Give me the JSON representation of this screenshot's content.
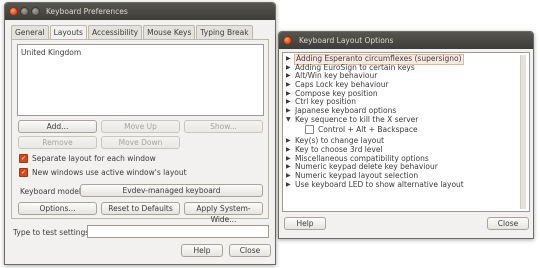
{
  "prefs": {
    "title": "Keyboard Preferences",
    "tabs": [
      "General",
      "Layouts",
      "Accessibility",
      "Mouse Keys",
      "Typing Break"
    ],
    "layouts": [
      "United Kingdom"
    ],
    "buttons": {
      "add": "Add...",
      "move_up": "Move Up",
      "show": "Show...",
      "remove": "Remove",
      "move_down": "Move Down",
      "options": "Options...",
      "reset": "Reset to Defaults",
      "apply": "Apply System-Wide...",
      "help": "Help",
      "close": "Close"
    },
    "checks": [
      {
        "label": "Separate layout for each window",
        "checked": true
      },
      {
        "label": "New windows use active window's layout",
        "checked": true
      }
    ],
    "model_label": "Keyboard model:",
    "model_value": "Evdev-managed keyboard",
    "test_label": "Type to test settings:",
    "test_value": ""
  },
  "options": {
    "title": "Keyboard Layout Options",
    "items": [
      {
        "label": "Adding Esperanto circumflexes (supersigno)",
        "expanded": false,
        "selected": true
      },
      {
        "label": "Adding EuroSign to certain keys",
        "expanded": false
      },
      {
        "label": "Alt/Win key behaviour",
        "expanded": false
      },
      {
        "label": "Caps Lock key behaviour",
        "expanded": false
      },
      {
        "label": "Compose key position",
        "expanded": false
      },
      {
        "label": "Ctrl key position",
        "expanded": false
      },
      {
        "label": "Japanese keyboard options",
        "expanded": false
      },
      {
        "label": "Key sequence to kill the X server",
        "expanded": true,
        "children": [
          {
            "label": "Control + Alt + Backspace",
            "checked": false
          }
        ]
      },
      {
        "label": "Key(s) to change layout",
        "expanded": false
      },
      {
        "label": "Key to choose 3rd level",
        "expanded": false
      },
      {
        "label": "Miscellaneous compatibility options",
        "expanded": false
      },
      {
        "label": "Numeric keypad delete key behaviour",
        "expanded": false
      },
      {
        "label": "Numeric keypad layout selection",
        "expanded": false
      },
      {
        "label": "Use keyboard LED to show alternative layout",
        "expanded": false
      }
    ],
    "help": "Help",
    "close": "Close"
  },
  "colors": {
    "accent": "#dd4814",
    "titlebar": "#3e3d39",
    "window_bg": "#f2f1ef"
  }
}
